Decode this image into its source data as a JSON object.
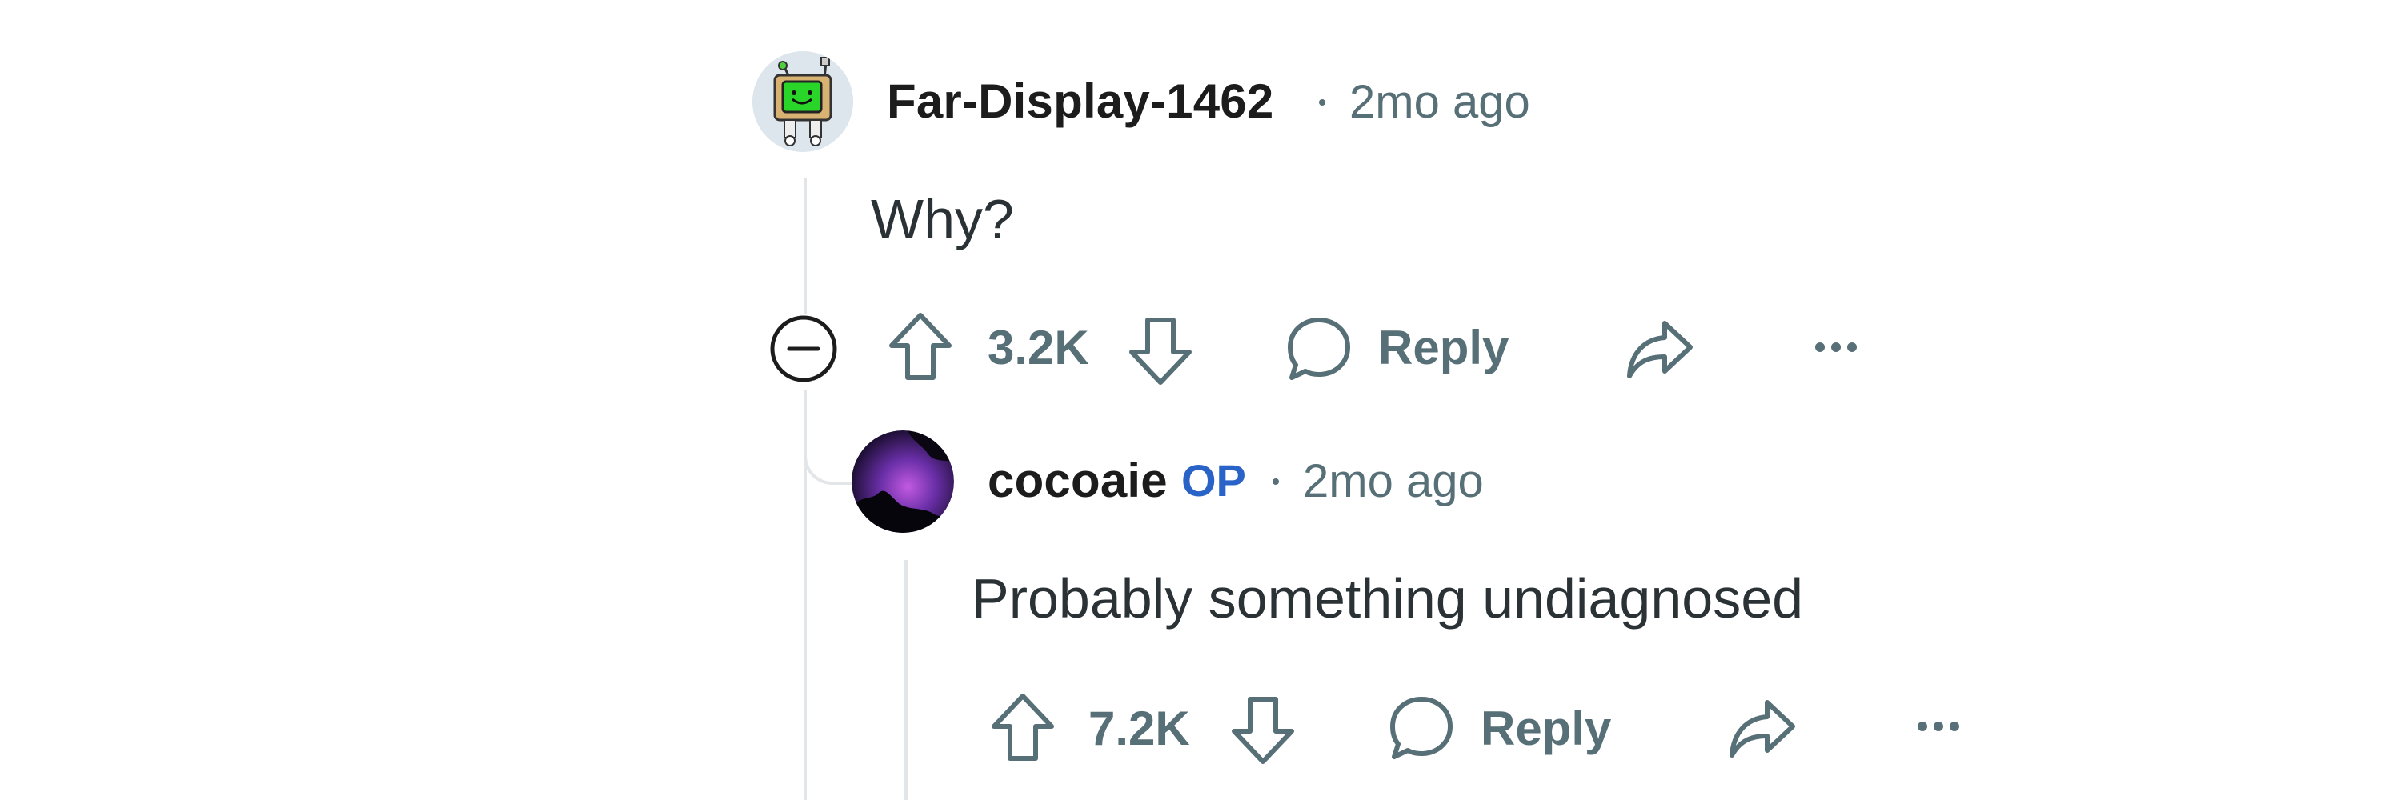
{
  "comments": [
    {
      "username": "Far-Display-1462",
      "timestamp": "2mo ago",
      "body": "Why?",
      "vote_count": "3.2K",
      "reply_label": "Reply",
      "avatar": "robot-avatar-icon"
    },
    {
      "username": "cocoaie",
      "op_badge": "OP",
      "timestamp": "2mo ago",
      "body": "Probably something undiagnosed",
      "vote_count": "7.2K",
      "reply_label": "Reply",
      "avatar": "aurora-avatar-icon"
    }
  ],
  "icons": {
    "collapse": "collapse-minus-icon",
    "upvote": "upvote-arrow-icon",
    "downvote": "downvote-arrow-icon",
    "reply": "speech-bubble-icon",
    "share": "share-arrow-icon",
    "more": "more-options-icon"
  },
  "colors": {
    "meta_gray": "#576f76",
    "op_blue": "#2a63c7",
    "thread_line": "#e3e6e8",
    "text_dark": "#1c1c1c"
  }
}
